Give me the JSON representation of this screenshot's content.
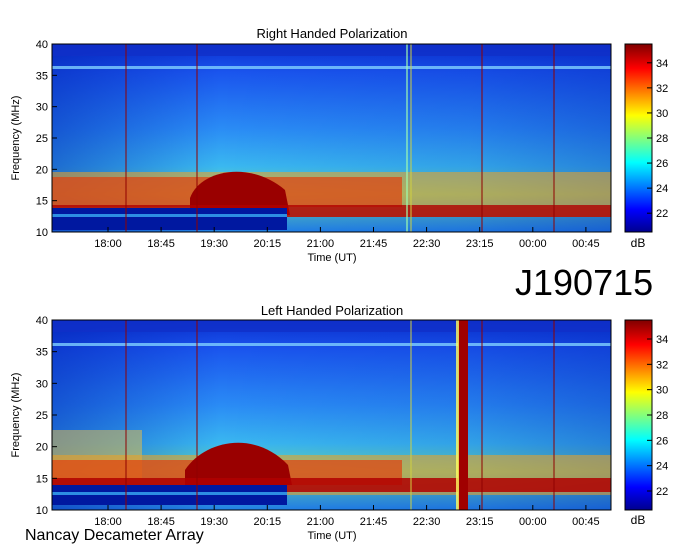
{
  "observation_id": "J190715",
  "footer": "Nancay Decameter Array",
  "chart_data": [
    {
      "type": "heatmap",
      "title": "Right Handed Polarization",
      "xlabel": "Time (UT)",
      "ylabel": "Frequency (MHz)",
      "x_ticks": [
        "18:00",
        "18:45",
        "19:30",
        "20:15",
        "21:00",
        "21:45",
        "22:30",
        "23:15",
        "00:00",
        "00:45"
      ],
      "y_ticks": [
        10,
        15,
        20,
        25,
        30,
        35,
        40
      ],
      "ylim": [
        10,
        40
      ],
      "colorbar": {
        "label": "dB",
        "ticks": [
          22,
          24,
          26,
          28,
          30,
          32,
          34
        ],
        "range": [
          20.5,
          35.5
        ]
      },
      "features": {
        "burst_region": "lower frequencies 10-20 MHz, strongest around 19:30-20:15 UT"
      }
    },
    {
      "type": "heatmap",
      "title": "Left Handed Polarization",
      "xlabel": "Time (UT)",
      "ylabel": "Frequency (MHz)",
      "x_ticks": [
        "18:00",
        "18:45",
        "19:30",
        "20:15",
        "21:00",
        "21:45",
        "22:30",
        "23:15",
        "00:00",
        "00:45"
      ],
      "y_ticks": [
        10,
        15,
        20,
        25,
        30,
        35,
        40
      ],
      "ylim": [
        10,
        40
      ],
      "colorbar": {
        "label": "dB",
        "ticks": [
          22,
          24,
          26,
          28,
          30,
          32,
          34
        ],
        "range": [
          20.5,
          35.5
        ]
      },
      "features": {
        "burst_region": "lower frequencies 10-20 MHz, strongest around 19:30-20:15 UT"
      }
    }
  ],
  "colors": {
    "low": "#00008f",
    "mid": "#00ffff",
    "high": "#ffff00",
    "max": "#7f0000"
  }
}
